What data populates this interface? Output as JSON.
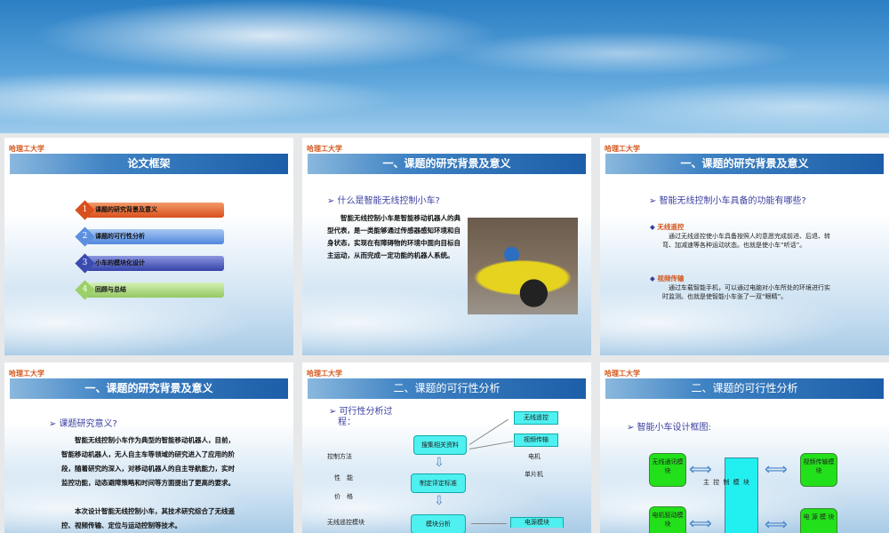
{
  "university": "哈理工大学",
  "slides": [
    {
      "title": "论文框架",
      "items": [
        {
          "num": "1",
          "label": "课题的研究背景及意义",
          "color": "#e2622a"
        },
        {
          "num": "2",
          "label": "课题的可行性分析",
          "color": "#5b8fe0"
        },
        {
          "num": "3",
          "label": "小车的模块化设计",
          "color": "#3a4cb0"
        },
        {
          "num": "4",
          "label": "回顾与总结",
          "color": "#9bcf6a"
        }
      ]
    },
    {
      "title": "一、课题的研究背景及意义",
      "question": "➢ 什么是智能无线控制小车?",
      "paragraph": "　　智能无线控制小车是智能移动机器人的典型代表，是一类能够通过传感器感知环境和自身状态，实现在有障碍物的环境中面向目标自主运动，从而完成一定功能的机器人系统。"
    },
    {
      "title": "一、课题的研究背景及意义",
      "question": "➢  智能无线控制小车具备的功能有哪些?",
      "bullets": [
        {
          "head": "无线遥控",
          "text": "　通过无线遥控使小车具备按照人的意愿完成前进、后退、转弯、加减速等各种运动状态。也就是使小车“听话”。"
        },
        {
          "head": "视频传输",
          "text": "　通过车载智能手机，可以通过电脑对小车所处的环境进行实时监测。也就是使智能小车张了一双“眼睛”。"
        }
      ]
    },
    {
      "title": "一、课题的研究背景及意义",
      "question": "➢  课题研究意义?",
      "paragraphs": [
        "　　智能无线控制小车作为典型的智能移动机器人，目前，智能移动机器人，无人自主车等领域的研究进入了应用的阶段，随着研究的深入，对移动机器人的自主导航能力，实时监控功能，动态避障策略和时间等方面提出了更高的要求。",
        "　　本次设计智能无线控制小车，其技术研究综合了无线遥控、视频传输、定位与运动控制等技术。"
      ]
    },
    {
      "title": "二、课题的可行性分析",
      "question": "➢ 可行性分析过\n　程：",
      "left_labels": [
        "控制方法",
        "性　能",
        "价　格",
        "无线遥控模块"
      ],
      "flow": [
        "搜集相关资料",
        "制定评定标准",
        "模块分析"
      ],
      "right_boxes": [
        "无线遥控",
        "视频传输"
      ],
      "right_labels": [
        "电机",
        "单片机"
      ],
      "power": "电源模块"
    },
    {
      "title": "二、课题的可行性分析",
      "question": "➢  智能小车设计框图:",
      "main": "主 控 制 模 块",
      "modules": [
        "无线通讯模块",
        "视频传输模块",
        "电机驱动模块",
        "电 源 模 块"
      ]
    }
  ]
}
